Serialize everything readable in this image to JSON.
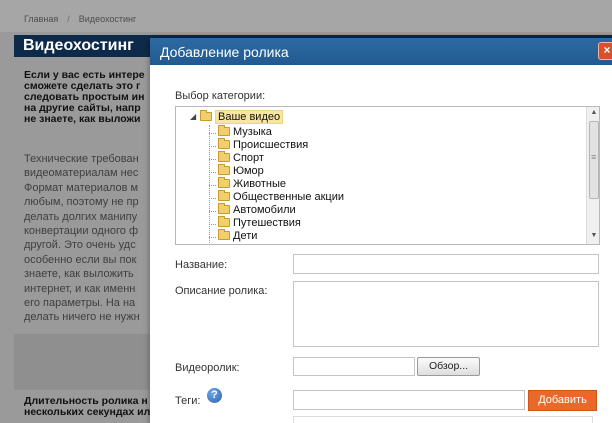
{
  "breadcrumb": {
    "home": "Главная",
    "separator": "/",
    "current": "Видеохостинг"
  },
  "page": {
    "title": "Видеохостинг",
    "intro_lines": [
      "Если у вас есть интере",
      "сможете сделать это г",
      "следовать простым ин",
      "на другие сайты, напр",
      "не знаете, как выложи"
    ],
    "tech_lines": [
      "Технические требован",
      "видеоматериалам нес",
      "Формат материалов м",
      "любым, поэтому не пр",
      "делать долгих манипу",
      "конвертации одного ф",
      "другой. Это очень удс",
      "особенно если вы пок",
      "знаете, как выложить",
      "интернет, и как именн",
      "его параметры. На на",
      "делать ничего не нужн"
    ],
    "duration_lines": [
      "Длительность ролика н",
      "нескольких секундах ил"
    ]
  },
  "modal": {
    "title": "Добавление ролика",
    "close_icon": "close-icon",
    "category_label": "Выбор категории:",
    "tree": {
      "root": "Ваше видео",
      "items": [
        "Музыка",
        "Происшествия",
        "Спорт",
        "Юмор",
        "Животные",
        "Общественные акции",
        "Автомобили",
        "Путешествия",
        "Дети"
      ]
    },
    "name_label": "Название:",
    "name_value": "",
    "description_label": "Описание ролика:",
    "description_value": "",
    "video_label": "Видеоролик:",
    "browse_label": "Обзор...",
    "tags_label": "Теги:",
    "tags_value": "",
    "add_label": "Добавить"
  },
  "colors": {
    "header_blue": "#2e6aa2",
    "page_title_bg": "#0e2a4a",
    "add_button": "#e9692a",
    "close_button": "#d9502d",
    "overlay": "#9a9a9a"
  }
}
